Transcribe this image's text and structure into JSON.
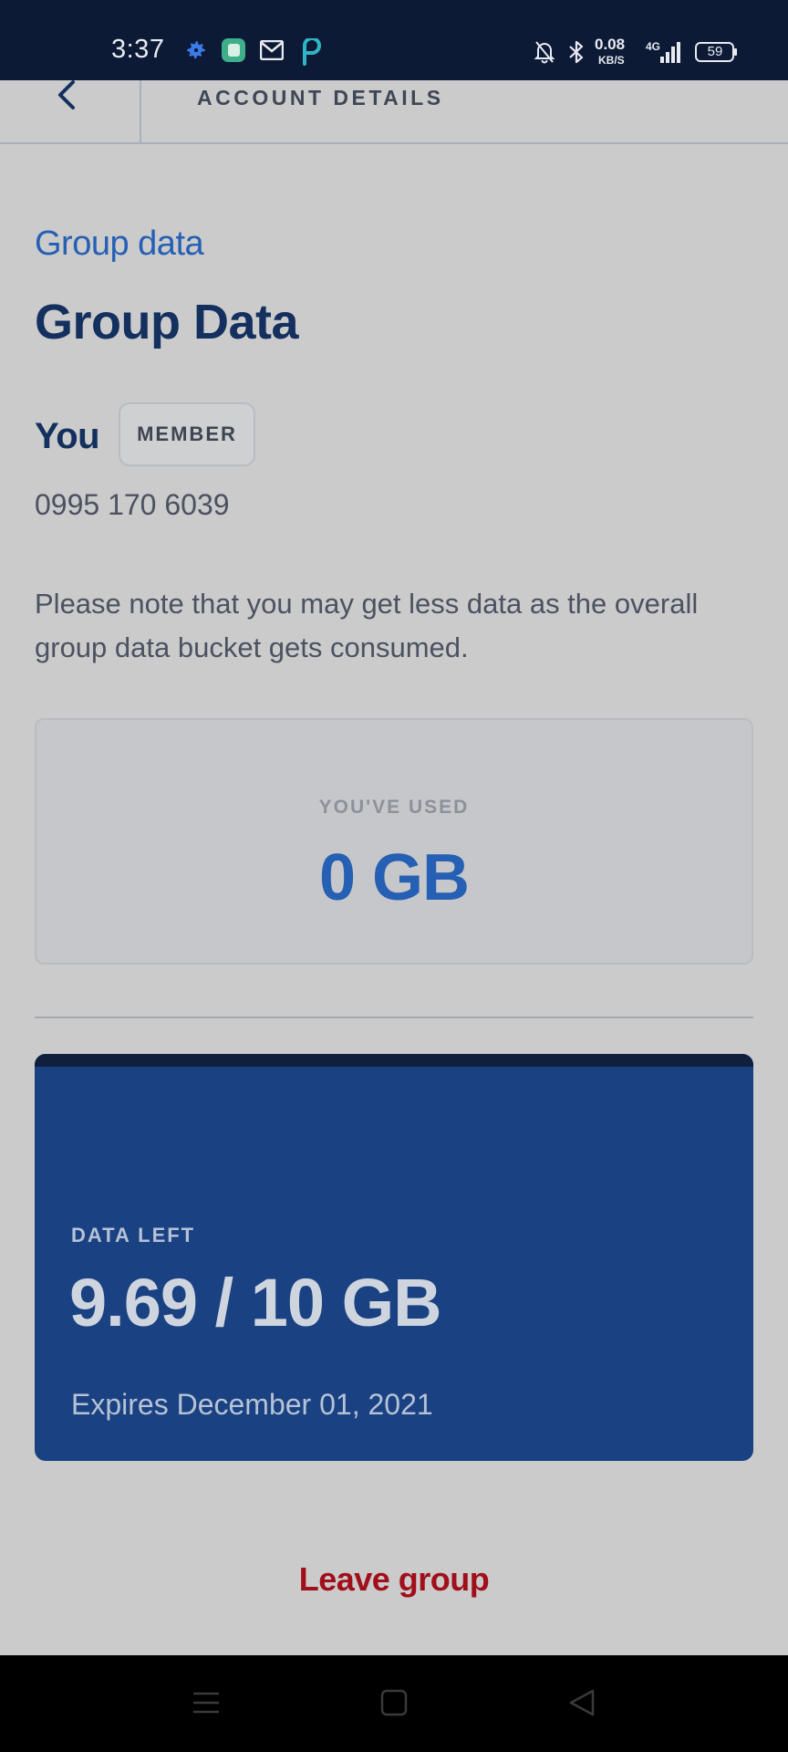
{
  "status_bar": {
    "time": "3:37",
    "net_speed_value": "0.08",
    "net_speed_unit": "KB/S",
    "network_type": "4G",
    "battery": "59",
    "icons": [
      "settings-gear-icon",
      "app-green-icon",
      "gmail-icon",
      "p-app-icon",
      "bell-muted-icon",
      "bluetooth-icon",
      "signal-icon",
      "battery-icon"
    ]
  },
  "header": {
    "title": "ACCOUNT DETAILS",
    "back_icon": "chevron-left-icon"
  },
  "section_eyebrow": "Group data",
  "page_title": "Group Data",
  "member": {
    "name": "You",
    "badge": "MEMBER",
    "phone": "0995 170 6039"
  },
  "note": "Please note that you may get less data as the overall group data bucket gets consumed.",
  "usage_card": {
    "label": "YOU'VE USED",
    "value": "0 GB"
  },
  "data_left_card": {
    "label": "DATA LEFT",
    "value": "9.69 / 10 GB",
    "expires": "Expires December 01, 2021"
  },
  "leave_button": "Leave group",
  "colors": {
    "accent_blue": "#2560b4",
    "title_navy": "#13305e",
    "card_blue": "#1a4182",
    "danger_red": "#a10f1a"
  }
}
